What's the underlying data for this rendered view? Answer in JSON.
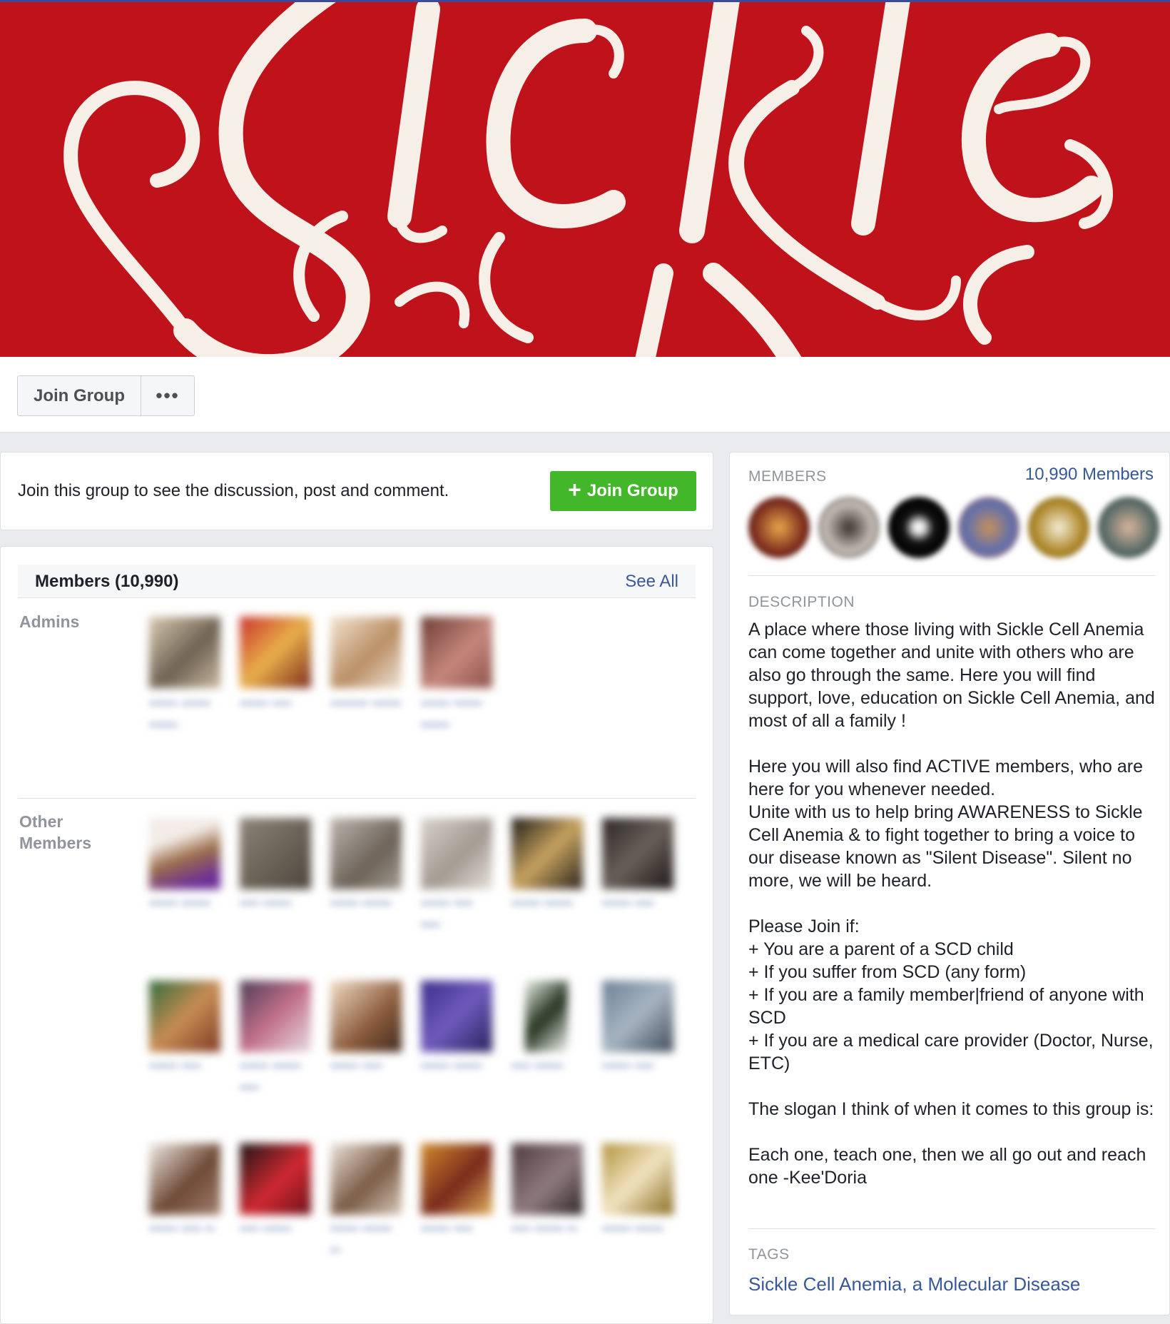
{
  "cover": {
    "artwork_text": "Sickle",
    "background_color": "#c0121b"
  },
  "action_bar": {
    "join_label": "Join Group",
    "more_label": "•••"
  },
  "join_prompt": {
    "text": "Join this group to see the discussion, post and comment.",
    "button_label": "Join Group",
    "button_icon": "plus-icon"
  },
  "members_section": {
    "title": "Members (10,990)",
    "see_all": "See All",
    "admins_label": "Admins",
    "other_label": "Other Members"
  },
  "sidebar": {
    "members_label": "MEMBERS",
    "members_count_link": "10,990 Members",
    "description_label": "DESCRIPTION",
    "description_paragraphs": [
      "A place where those living with Sickle Cell Anemia can come together and unite with others who are also go through the same. Here you will find support, love, education on Sickle Cell Anemia, and most of all a family !",
      "Here you will also find ACTIVE members, who are here for you whenever needed.\nUnite with us to help bring AWARENESS to Sickle Cell Anemia & to fight together to bring a voice to our disease known as \"Silent Disease\". Silent no more, we will be heard.",
      "Please Join if:\n+ You are a parent of a SCD child\n+ If you suffer from SCD (any form)\n+ If you are a family member|friend of anyone with SCD\n+ If you are a medical care provider (Doctor, Nurse, ETC)",
      "The slogan I think of when it comes to this group is:",
      "Each one, teach one, then we all go out and reach one -Kee'Doria"
    ],
    "tags_label": "TAGS",
    "tag_link": "Sickle Cell Anemia, a Molecular Disease"
  },
  "colors": {
    "link": "#385898",
    "join_green": "#42b72a",
    "muted": "#90949c"
  }
}
